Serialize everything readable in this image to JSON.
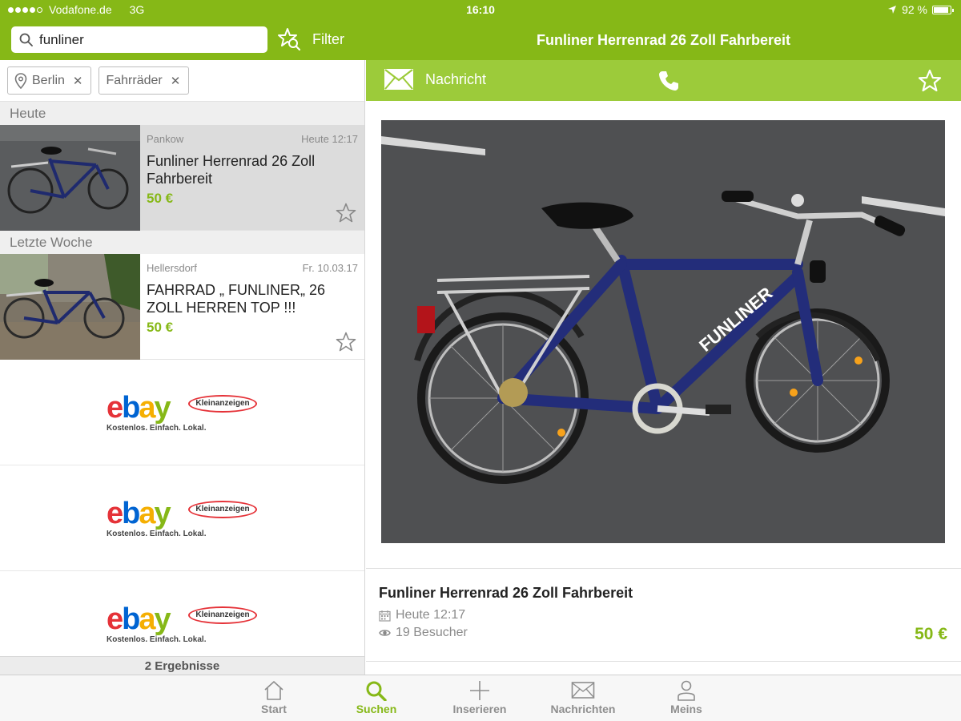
{
  "status_bar": {
    "carrier": "Vodafone.de",
    "network": "3G",
    "time": "16:10",
    "battery": "92 %",
    "battery_level": 0.92
  },
  "search": {
    "value": "funliner",
    "filter_label": "Filter"
  },
  "filters": [
    {
      "label": "Berlin",
      "icon": "location-pin-icon"
    },
    {
      "label": "Fahrräder"
    }
  ],
  "listings_sections": [
    {
      "header": "Heute",
      "items": [
        {
          "location": "Pankow",
          "date": "Heute 12:17",
          "title": "Funliner Herrenrad 26 Zoll Fahrbereit",
          "price": "50 €",
          "selected": true
        }
      ]
    },
    {
      "header": "Letzte Woche",
      "items": [
        {
          "location": "Hellersdorf",
          "date": "Fr. 10.03.17",
          "title": "FAHRRAD „ FUNLINER„ 26 ZOLL HERREN TOP !!!",
          "price": "50 €",
          "selected": false
        }
      ]
    }
  ],
  "ads": {
    "logo": "ebay",
    "badge": "Kleinanzeigen",
    "tagline": "Kostenlos. Einfach. Lokal.",
    "count": 3
  },
  "results_count": "2 Ergebnisse",
  "detail": {
    "header_title": "Funliner Herrenrad 26 Zoll Fahrbereit",
    "message_label": "Nachricht",
    "title": "Funliner Herrenrad 26 Zoll Fahrbereit",
    "date": "Heute 12:17",
    "visitors": "19 Besucher",
    "price": "50 €",
    "frame_lettering": "FUNLINER"
  },
  "tabs": [
    {
      "label": "Start",
      "icon": "home-icon",
      "active": false
    },
    {
      "label": "Suchen",
      "icon": "search-icon",
      "active": true
    },
    {
      "label": "Inserieren",
      "icon": "plus-icon",
      "active": false
    },
    {
      "label": "Nachrichten",
      "icon": "envelope-icon",
      "active": false
    },
    {
      "label": "Meins",
      "icon": "person-icon",
      "active": false
    }
  ],
  "colors": {
    "brand_green": "#86b817",
    "action_green": "#9ccb3a",
    "selected_row": "#dcdcdc"
  }
}
